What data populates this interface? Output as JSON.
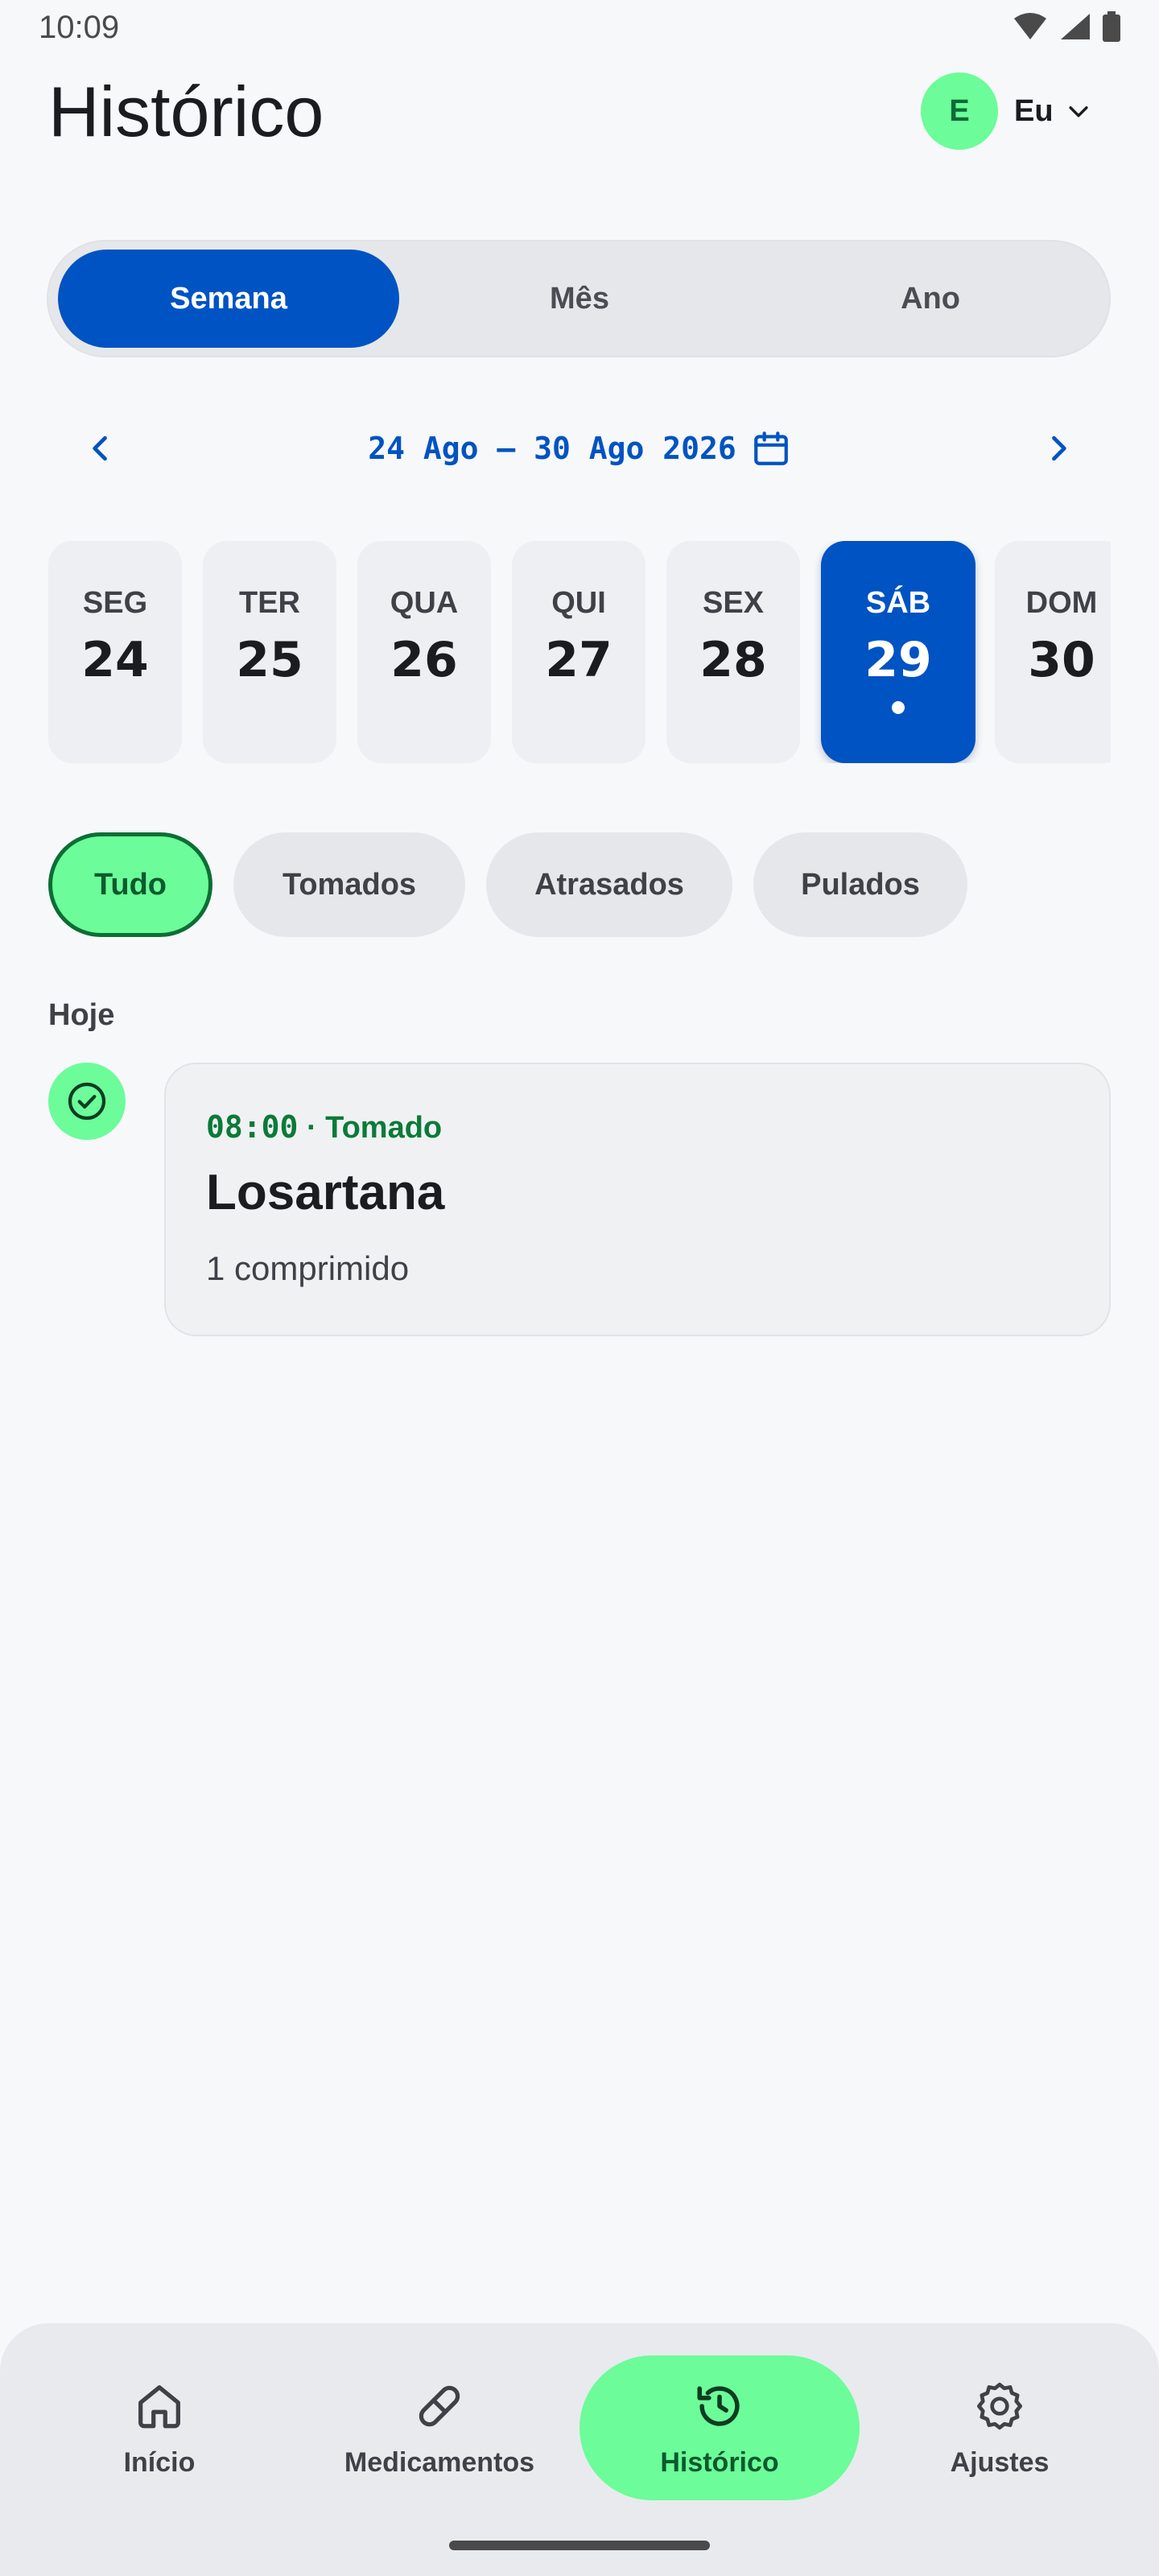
{
  "status_bar": {
    "time": "10:09"
  },
  "header": {
    "title": "Histórico",
    "profile_initial": "E",
    "profile_name": "Eu"
  },
  "segments": [
    {
      "label": "Semana",
      "active": true
    },
    {
      "label": "Mês",
      "active": false
    },
    {
      "label": "Ano",
      "active": false
    }
  ],
  "date_nav": {
    "range": "24 Ago – 30 Ago 2026"
  },
  "days": [
    {
      "name": "SEG",
      "num": "24"
    },
    {
      "name": "TER",
      "num": "25"
    },
    {
      "name": "QUA",
      "num": "26"
    },
    {
      "name": "QUI",
      "num": "27"
    },
    {
      "name": "SEX",
      "num": "28"
    },
    {
      "name": "SÁB",
      "num": "29",
      "active": true
    },
    {
      "name": "DOM",
      "num": "30"
    }
  ],
  "filters": [
    {
      "label": "Tudo",
      "active": true
    },
    {
      "label": "Tomados"
    },
    {
      "label": "Atrasados"
    },
    {
      "label": "Pulados"
    }
  ],
  "section": {
    "label": "Hoje"
  },
  "entry": {
    "time": "08:00",
    "status": "Tomado",
    "separator": " · ",
    "name": "Losartana",
    "dose": "1 comprimido"
  },
  "bottom_nav": [
    {
      "label": "Início",
      "icon": "home-icon"
    },
    {
      "label": "Medicamentos",
      "icon": "pill-icon"
    },
    {
      "label": "Histórico",
      "icon": "history-icon",
      "active": true
    },
    {
      "label": "Ajustes",
      "icon": "gear-icon"
    }
  ],
  "colors": {
    "primary": "#0053c2",
    "accent_green": "#6cfc9a",
    "success_text": "#0b7a39",
    "background": "#f7f8fa"
  }
}
